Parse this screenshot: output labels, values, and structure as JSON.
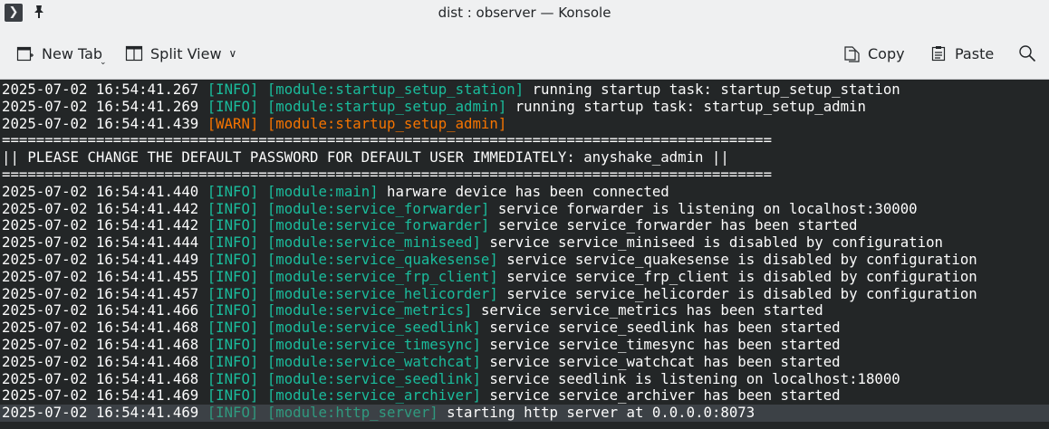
{
  "window": {
    "title": "dist : observer — Konsole"
  },
  "toolbar": {
    "new_tab": "New Tab",
    "split_view": "Split View",
    "copy": "Copy",
    "paste": "Paste"
  },
  "icons": {
    "app": "terminal-icon",
    "pin": "pin-icon",
    "new_tab": "new-tab-icon",
    "split_view": "split-view-icon",
    "copy": "copy-icon",
    "paste": "paste-icon",
    "find": "search-icon"
  },
  "colors": {
    "info": "#1abc9c",
    "warn": "#f67400",
    "terminal_bg": "#232627",
    "text": "#fcfcfc"
  },
  "log": [
    {
      "type": "log",
      "ts": "2025-07-02 16:54:41.267",
      "level": "[INFO]",
      "module": "[module:startup_setup_station]",
      "msg": "running startup task: startup_setup_station"
    },
    {
      "type": "log",
      "ts": "2025-07-02 16:54:41.269",
      "level": "[INFO]",
      "module": "[module:startup_setup_admin]",
      "msg": "running startup task: startup_setup_admin"
    },
    {
      "type": "log",
      "ts": "2025-07-02 16:54:41.439",
      "level": "[WARN]",
      "module": "[module:startup_setup_admin]",
      "msg": ""
    },
    {
      "type": "plain",
      "text": "=========================================================================================="
    },
    {
      "type": "plain",
      "text": "|| PLEASE CHANGE THE DEFAULT PASSWORD FOR DEFAULT USER IMMEDIATELY: anyshake_admin ||"
    },
    {
      "type": "plain",
      "text": "=========================================================================================="
    },
    {
      "type": "log",
      "ts": "2025-07-02 16:54:41.440",
      "level": "[INFO]",
      "module": "[module:main]",
      "msg": "harware device has been connected"
    },
    {
      "type": "log",
      "ts": "2025-07-02 16:54:41.442",
      "level": "[INFO]",
      "module": "[module:service_forwarder]",
      "msg": "service forwarder is listening on localhost:30000"
    },
    {
      "type": "log",
      "ts": "2025-07-02 16:54:41.442",
      "level": "[INFO]",
      "module": "[module:service_forwarder]",
      "msg": "service service_forwarder has been started"
    },
    {
      "type": "log",
      "ts": "2025-07-02 16:54:41.444",
      "level": "[INFO]",
      "module": "[module:service_miniseed]",
      "msg": "service service_miniseed is disabled by configuration"
    },
    {
      "type": "log",
      "ts": "2025-07-02 16:54:41.449",
      "level": "[INFO]",
      "module": "[module:service_quakesense]",
      "msg": "service service_quakesense is disabled by configuration"
    },
    {
      "type": "log",
      "ts": "2025-07-02 16:54:41.455",
      "level": "[INFO]",
      "module": "[module:service_frp_client]",
      "msg": "service service_frp_client is disabled by configuration"
    },
    {
      "type": "log",
      "ts": "2025-07-02 16:54:41.457",
      "level": "[INFO]",
      "module": "[module:service_helicorder]",
      "msg": "service service_helicorder is disabled by configuration"
    },
    {
      "type": "log",
      "ts": "2025-07-02 16:54:41.466",
      "level": "[INFO]",
      "module": "[module:service_metrics]",
      "msg": "service service_metrics has been started"
    },
    {
      "type": "log",
      "ts": "2025-07-02 16:54:41.468",
      "level": "[INFO]",
      "module": "[module:service_seedlink]",
      "msg": "service service_seedlink has been started"
    },
    {
      "type": "log",
      "ts": "2025-07-02 16:54:41.468",
      "level": "[INFO]",
      "module": "[module:service_timesync]",
      "msg": "service service_timesync has been started"
    },
    {
      "type": "log",
      "ts": "2025-07-02 16:54:41.468",
      "level": "[INFO]",
      "module": "[module:service_watchcat]",
      "msg": "service service_watchcat has been started"
    },
    {
      "type": "log",
      "ts": "2025-07-02 16:54:41.468",
      "level": "[INFO]",
      "module": "[module:service_seedlink]",
      "msg": "service seedlink is listening on localhost:18000"
    },
    {
      "type": "log",
      "ts": "2025-07-02 16:54:41.469",
      "level": "[INFO]",
      "module": "[module:service_archiver]",
      "msg": "service service_archiver has been started"
    },
    {
      "type": "log",
      "ts": "2025-07-02 16:54:41.469",
      "level": "[INFO]",
      "module": "[module:http_server]",
      "msg": "starting http server at 0.0.0.0:8073",
      "selected": true
    }
  ]
}
